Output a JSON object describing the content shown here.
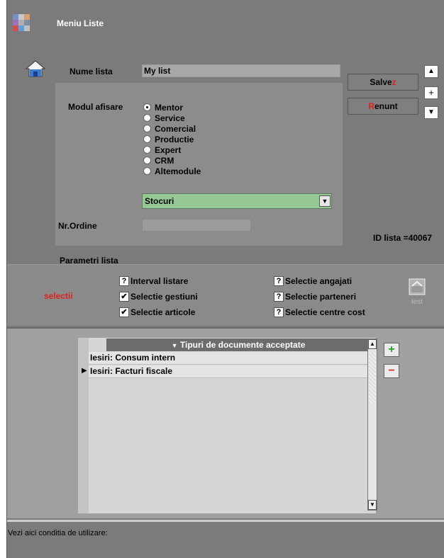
{
  "window": {
    "title": "Meniu Liste"
  },
  "form": {
    "name_label": "Nume lista",
    "name_value": "My list",
    "module_label": "Modul  afisare",
    "modules": [
      "Mentor",
      "Service",
      "Comercial",
      "Productie",
      "Expert",
      "CRM",
      "Altemodule"
    ],
    "selected_module": "Mentor",
    "submodule_value": "Stocuri",
    "order_label": "Nr.Ordine",
    "order_value": "",
    "id_label": "ID lista =40067"
  },
  "buttons": {
    "save_prefix": "Salve",
    "save_hot": "z",
    "cancel_hot": "R",
    "cancel_rest": "enunt",
    "up_symbol": "▲",
    "plus_symbol": "+",
    "down_symbol": "▼",
    "test_label": "test"
  },
  "params": {
    "header": "Parametri lista",
    "selection_label": "selectii",
    "left_options": [
      {
        "label": "Interval listare",
        "mark": "?"
      },
      {
        "label": "Selectie gestiuni",
        "mark": "✔"
      },
      {
        "label": "Selectie articole",
        "mark": "✔"
      }
    ],
    "right_options": [
      {
        "label": "Selectie angajati",
        "mark": "?"
      },
      {
        "label": "Selectie parteneri",
        "mark": "?"
      },
      {
        "label": "Selectie centre cost",
        "mark": "?"
      }
    ]
  },
  "grid": {
    "header": "Tipuri de documente acceptate",
    "rows": [
      "Iesiri: Consum intern",
      "Iesiri: Facturi fiscale"
    ],
    "current_row_marker": "▶",
    "add_symbol": "+",
    "remove_symbol": "−"
  },
  "status": {
    "text": "Vezi aici conditia de utilizare:"
  },
  "colors": {
    "accent_red": "#e02020",
    "combo_green": "#96c896",
    "window_gray": "#7b7b7b"
  }
}
